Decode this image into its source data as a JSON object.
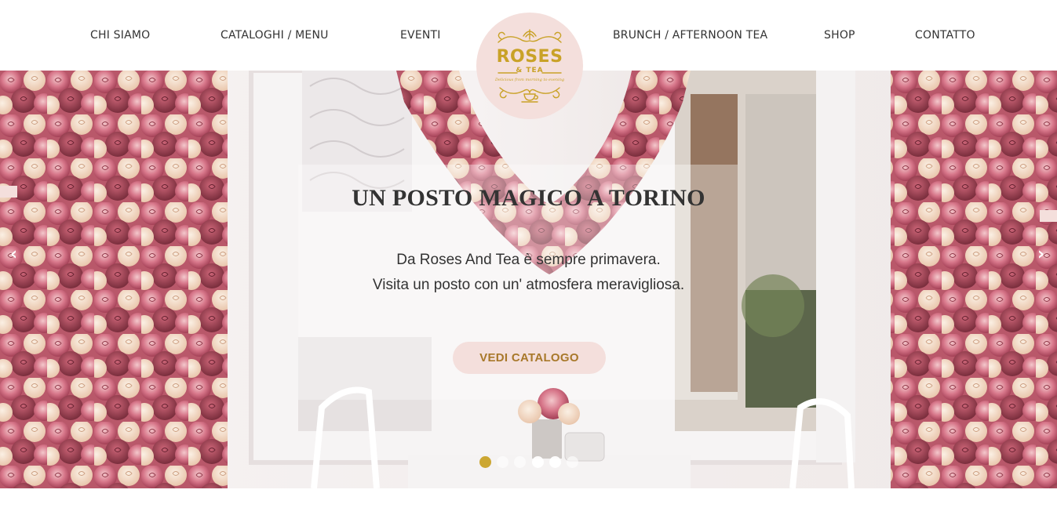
{
  "nav": {
    "left": [
      "CHI SIAMO",
      "CATALOGHI / MENU",
      "EVENTI"
    ],
    "right": [
      "BRUNCH / AFTERNOON TEA",
      "SHOP",
      "CONTATTO"
    ]
  },
  "logo": {
    "word1": "ROSES",
    "word2": "& TEA",
    "tagline": "Delicious from morning to evening"
  },
  "hero": {
    "title": "UN POSTO MAGICO A TORINO",
    "line1": "Da Roses And Tea è sempre primavera.",
    "line2": "Visita un posto con un' atmosfera meravigliosa.",
    "cta": "VEDI CATALOGO",
    "prev_arrow": "‹",
    "next_arrow": "›",
    "slides_count": 6,
    "active_slide": 1
  },
  "colors": {
    "accent_gold": "#c9a227",
    "blush": "#f4dfdc",
    "text": "#333333"
  }
}
